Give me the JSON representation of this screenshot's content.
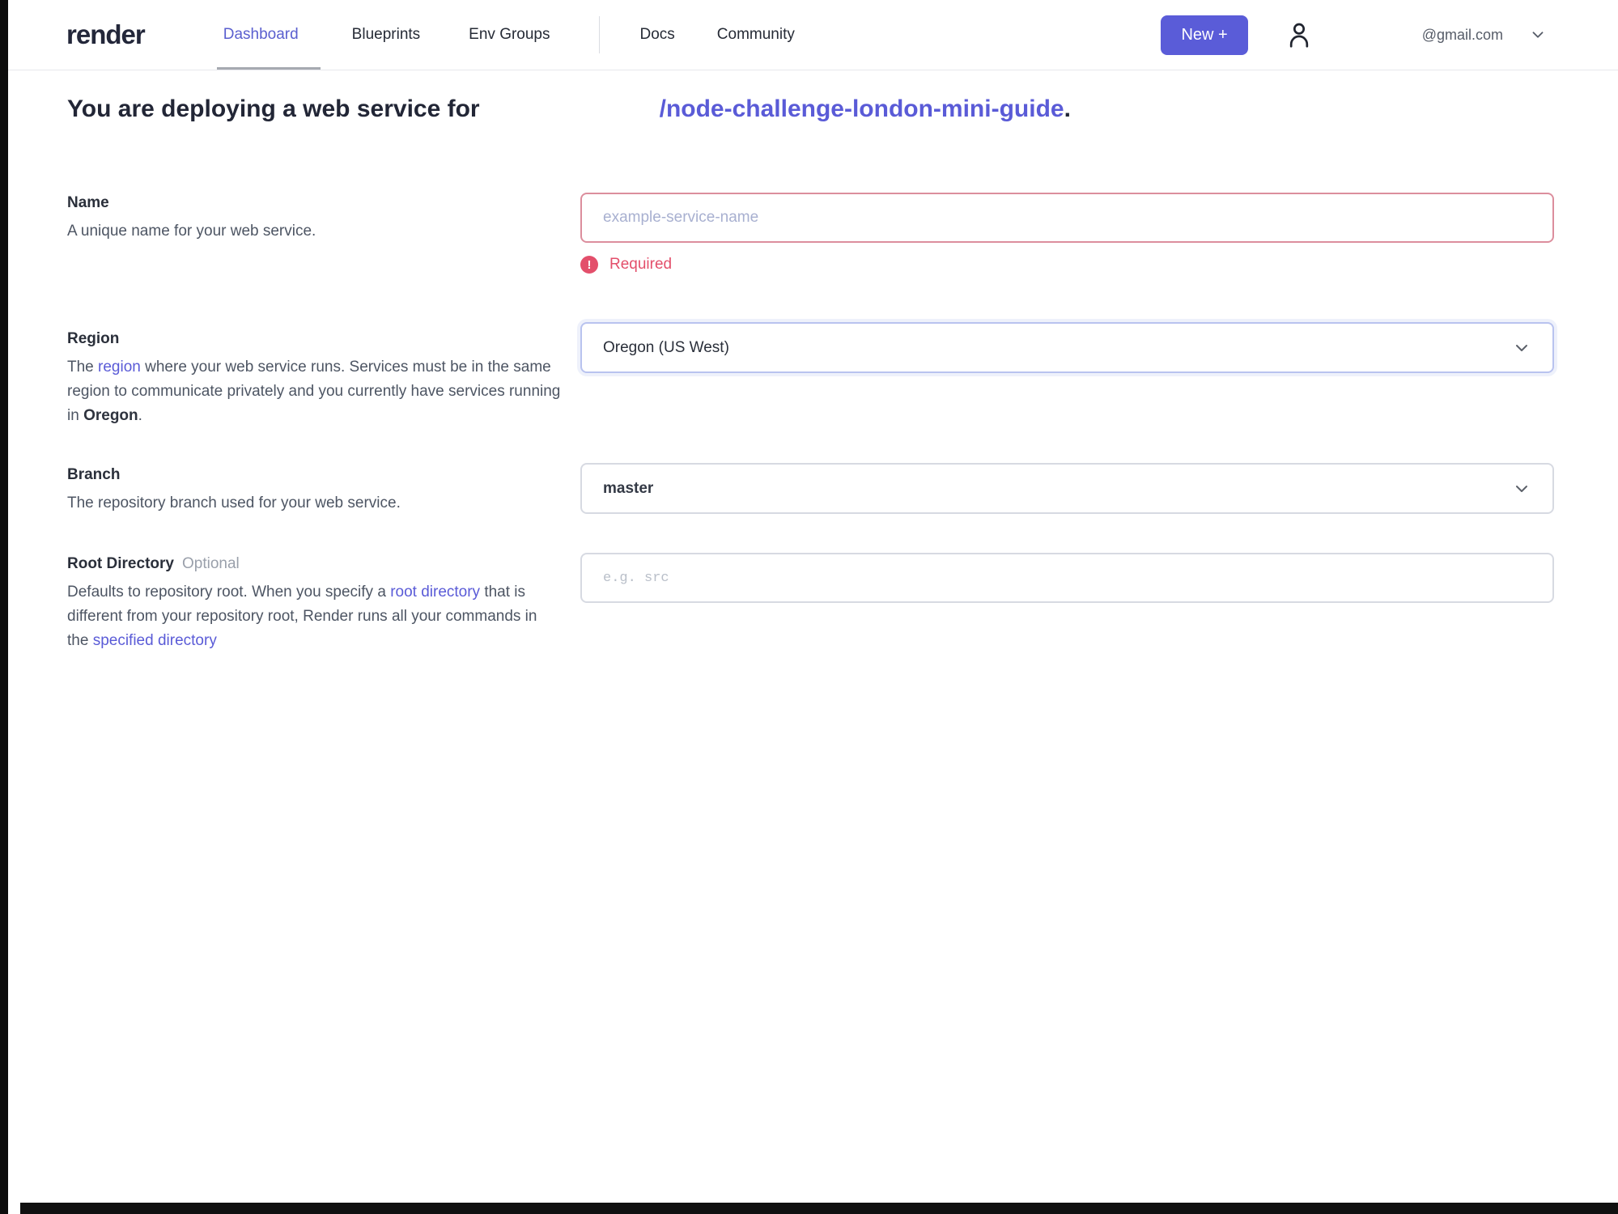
{
  "nav": {
    "logo": "render",
    "items": [
      {
        "label": "Dashboard",
        "active": true
      },
      {
        "label": "Blueprints",
        "active": false
      },
      {
        "label": "Env Groups",
        "active": false
      },
      {
        "label": "Docs",
        "active": false
      },
      {
        "label": "Community",
        "active": false
      }
    ],
    "new_button_label": "New +",
    "account_email": "@gmail.com"
  },
  "heading": {
    "prefix": "You are deploying a web service for",
    "repo_link": "/node-challenge-london-mini-guide",
    "suffix": "."
  },
  "form": {
    "name": {
      "label": "Name",
      "description": "A unique name for your web service.",
      "placeholder": "example-service-name",
      "error": "Required",
      "error_icon": "!"
    },
    "region": {
      "label": "Region",
      "desc_pre": "The ",
      "desc_link": "region",
      "desc_mid": " where your web service runs. Services must be in the same region to communicate privately and you currently have services running in ",
      "desc_bold": "Oregon",
      "desc_end": ".",
      "value": "Oregon (US West)"
    },
    "branch": {
      "label": "Branch",
      "description": "The repository branch used for your web service.",
      "value": "master"
    },
    "root_directory": {
      "label": "Root Directory",
      "optional": "Optional",
      "desc_1": "Defaults to repository root. When you specify a ",
      "desc_link1": "root directory",
      "desc_2": " that is different from your repository root, Render runs all your commands in the ",
      "desc_link2": "specified directory",
      "placeholder": "e.g. src"
    }
  },
  "colors": {
    "accent": "#5a5cd8",
    "link": "#5a5bd7",
    "error": "#e34f6b",
    "error_border": "#dc8e9d",
    "focus_border": "#b9c3ef",
    "border_gray": "#d7dae2",
    "heading_text": "#222636",
    "body_text": "#4d5563"
  }
}
